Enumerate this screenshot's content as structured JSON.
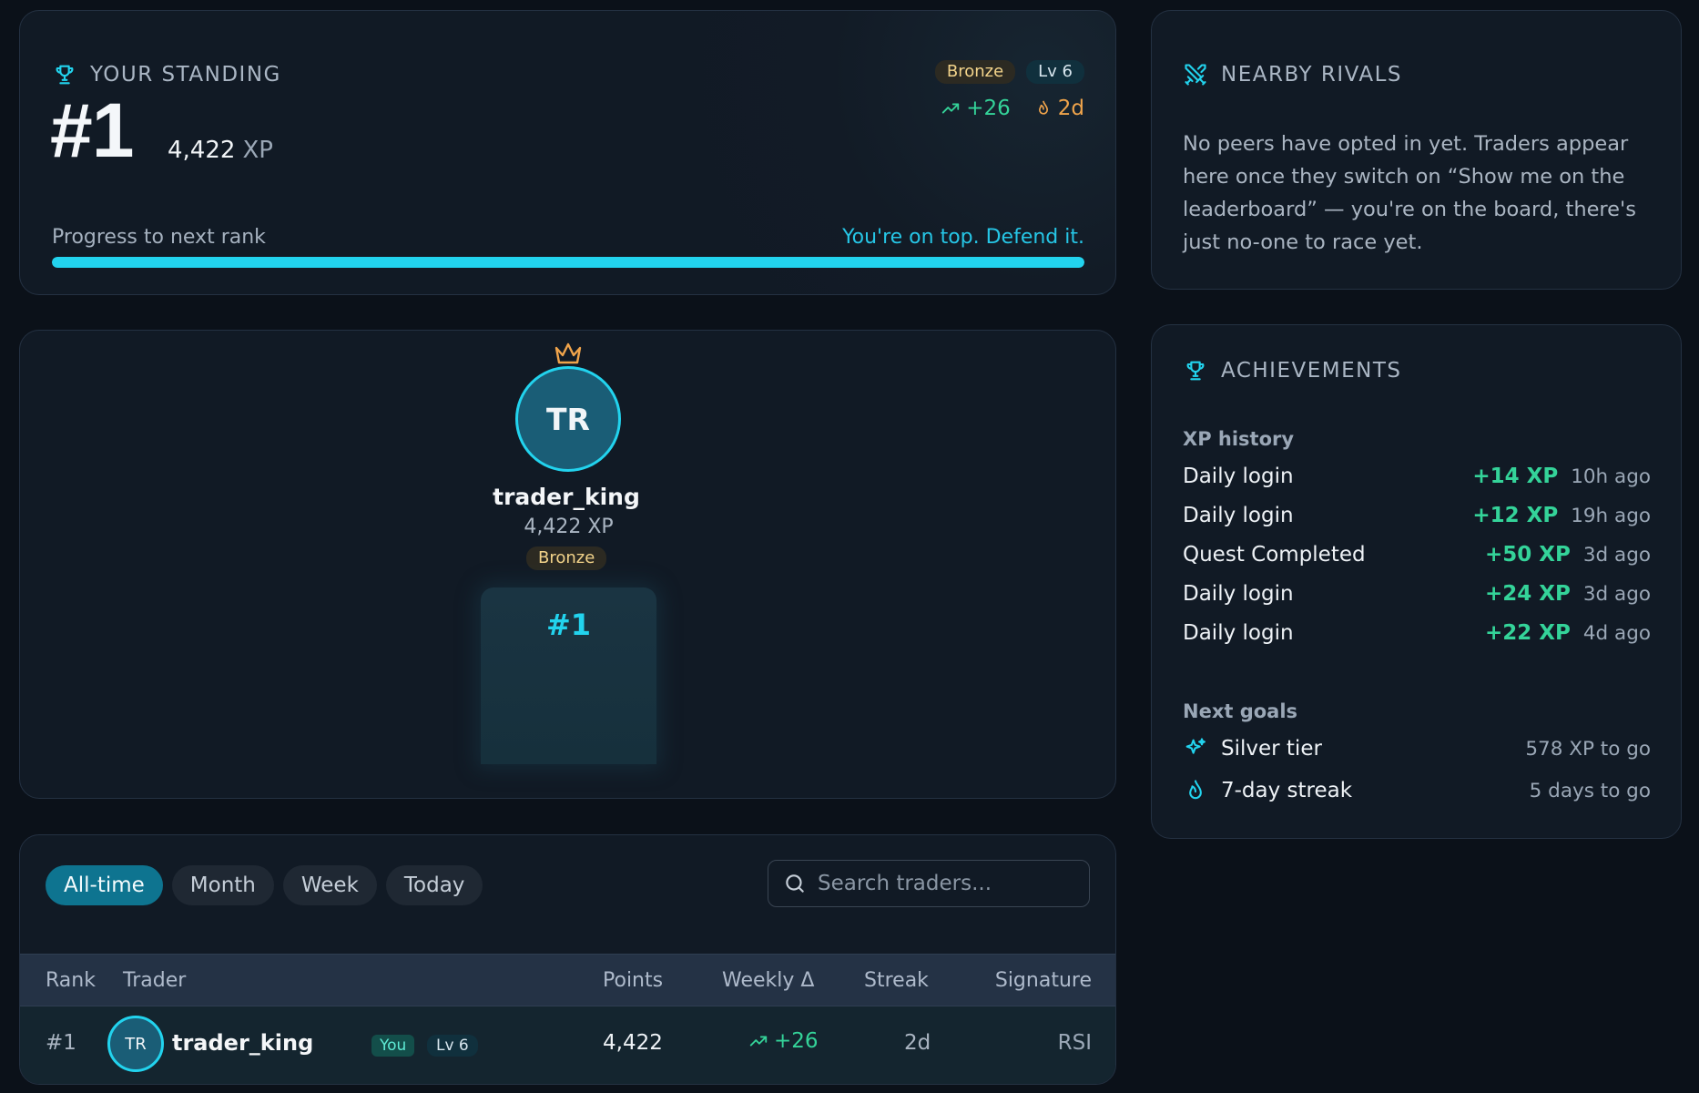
{
  "standing": {
    "header": "YOUR STANDING",
    "rank": "#1",
    "xp_value": "4,422",
    "xp_unit": "XP",
    "tier_badge": "Bronze",
    "level_badge": "Lv 6",
    "weekly_change": "+26",
    "streak": "2d",
    "progress_label": "Progress to next rank",
    "progress_message": "You're on top. Defend it.",
    "progress_fraction": 1.0
  },
  "podium": {
    "initials": "TR",
    "name": "trader_king",
    "xp": "4,422 XP",
    "tier": "Bronze",
    "rank": "#1"
  },
  "leaderboard": {
    "tabs": [
      "All-time",
      "Month",
      "Week",
      "Today"
    ],
    "active_tab": "All-time",
    "search_placeholder": "Search traders...",
    "columns": [
      "Rank",
      "Trader",
      "Points",
      "Weekly Δ",
      "Streak",
      "Signature"
    ],
    "rows": [
      {
        "rank": "#1",
        "initials": "TR",
        "name": "trader_king",
        "you_badge": "You",
        "level": "Lv 6",
        "points": "4,422",
        "weekly": "+26",
        "streak": "2d",
        "signature": "RSI"
      }
    ]
  },
  "rivals": {
    "header": "NEARBY RIVALS",
    "message": "No peers have opted in yet. Traders appear here once they switch on “Show me on the leaderboard” — you're on the board, there's just no-one to race yet."
  },
  "achievements": {
    "header": "ACHIEVEMENTS",
    "history_title": "XP history",
    "history": [
      {
        "label": "Daily login",
        "amount": "+14 XP",
        "time": "10h ago"
      },
      {
        "label": "Daily login",
        "amount": "+12 XP",
        "time": "19h ago"
      },
      {
        "label": "Quest Completed",
        "amount": "+50 XP",
        "time": "3d ago"
      },
      {
        "label": "Daily login",
        "amount": "+24 XP",
        "time": "3d ago"
      },
      {
        "label": "Daily login",
        "amount": "+22 XP",
        "time": "4d ago"
      }
    ],
    "goals_title": "Next goals",
    "goals": [
      {
        "icon": "sparkles-icon",
        "label": "Silver tier",
        "to_go": "578 XP to go"
      },
      {
        "icon": "flame-icon",
        "label": "7-day streak",
        "to_go": "5 days to go"
      }
    ]
  },
  "colors": {
    "accent": "#22d3ee",
    "positive": "#34d399",
    "streak": "#f0a44b",
    "tier_bronze": "#f2d38a",
    "background": "#0b1119",
    "card": "#111a25"
  }
}
